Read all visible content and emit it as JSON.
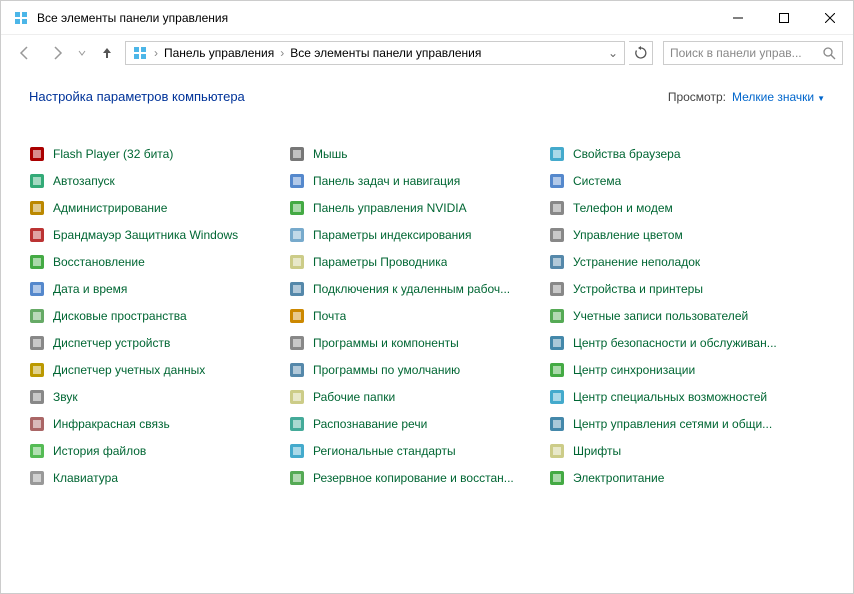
{
  "window": {
    "title": "Все элементы панели управления"
  },
  "breadcrumb": {
    "root": "Панель управления",
    "current": "Все элементы панели управления"
  },
  "search": {
    "placeholder": "Поиск в панели управ..."
  },
  "heading": "Настройка параметров компьютера",
  "view": {
    "label": "Просмотр:",
    "value": "Мелкие значки"
  },
  "items": [
    {
      "label": "Flash Player (32 бита)",
      "color": "#a00"
    },
    {
      "label": "Автозапуск",
      "color": "#3a7"
    },
    {
      "label": "Администрирование",
      "color": "#b80"
    },
    {
      "label": "Брандмауэр Защитника Windows",
      "color": "#b33"
    },
    {
      "label": "Восстановление",
      "color": "#4a4"
    },
    {
      "label": "Дата и время",
      "color": "#58c"
    },
    {
      "label": "Дисковые пространства",
      "color": "#6a6"
    },
    {
      "label": "Диспетчер устройств",
      "color": "#888"
    },
    {
      "label": "Диспетчер учетных данных",
      "color": "#b90"
    },
    {
      "label": "Звук",
      "color": "#888"
    },
    {
      "label": "Инфракрасная связь",
      "color": "#a66"
    },
    {
      "label": "История файлов",
      "color": "#5b5"
    },
    {
      "label": "Клавиатура",
      "color": "#999"
    },
    {
      "label": "Мышь",
      "color": "#777"
    },
    {
      "label": "Панель задач и навигация",
      "color": "#58c"
    },
    {
      "label": "Панель управления NVIDIA",
      "color": "#4a4"
    },
    {
      "label": "Параметры индексирования",
      "color": "#7ac"
    },
    {
      "label": "Параметры Проводника",
      "color": "#cc8"
    },
    {
      "label": "Подключения к удаленным рабоч...",
      "color": "#58a"
    },
    {
      "label": "Почта",
      "color": "#c80"
    },
    {
      "label": "Программы и компоненты",
      "color": "#888"
    },
    {
      "label": "Программы по умолчанию",
      "color": "#58a"
    },
    {
      "label": "Рабочие папки",
      "color": "#cc8"
    },
    {
      "label": "Распознавание речи",
      "color": "#4a9"
    },
    {
      "label": "Региональные стандарты",
      "color": "#4ac"
    },
    {
      "label": "Резервное копирование и восстан...",
      "color": "#5a5"
    },
    {
      "label": "Свойства браузера",
      "color": "#4ac"
    },
    {
      "label": "Система",
      "color": "#58c"
    },
    {
      "label": "Телефон и модем",
      "color": "#888"
    },
    {
      "label": "Управление цветом",
      "color": "#888"
    },
    {
      "label": "Устранение неполадок",
      "color": "#58a"
    },
    {
      "label": "Устройства и принтеры",
      "color": "#888"
    },
    {
      "label": "Учетные записи пользователей",
      "color": "#5a5"
    },
    {
      "label": "Центр безопасности и обслуживан...",
      "color": "#48a"
    },
    {
      "label": "Центр синхронизации",
      "color": "#4a4"
    },
    {
      "label": "Центр специальных возможностей",
      "color": "#4ac"
    },
    {
      "label": "Центр управления сетями и общи...",
      "color": "#48a"
    },
    {
      "label": "Шрифты",
      "color": "#cc8"
    },
    {
      "label": "Электропитание",
      "color": "#4a4"
    }
  ]
}
